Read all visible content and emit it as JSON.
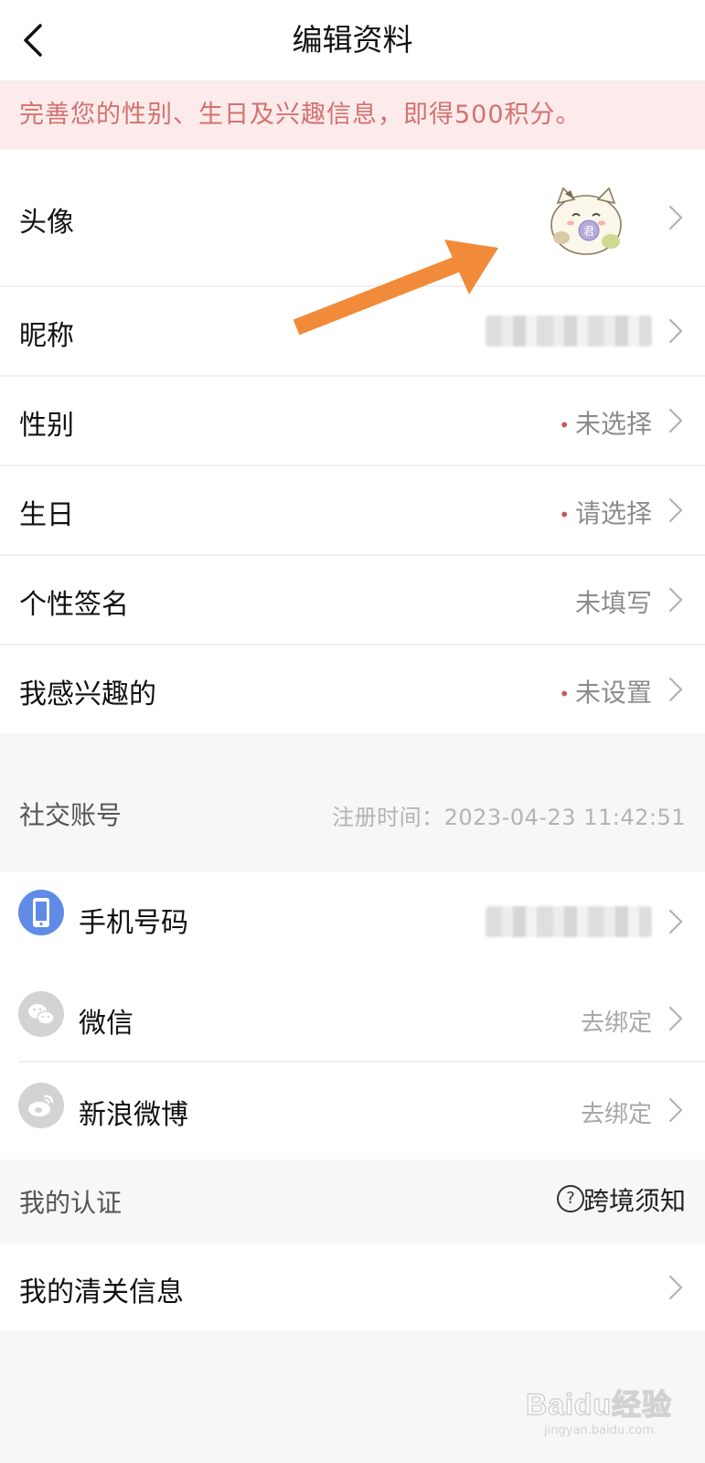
{
  "header": {
    "title": "编辑资料"
  },
  "banner": {
    "text": "完善您的性别、生日及兴趣信息，即得500积分。"
  },
  "profile": {
    "avatar_label": "头像",
    "avatar_badge": "君",
    "nickname_label": "昵称",
    "gender_label": "性别",
    "gender_value": "未选择",
    "birthday_label": "生日",
    "birthday_value": "请选择",
    "signature_label": "个性签名",
    "signature_value": "未填写",
    "interests_label": "我感兴趣的",
    "interests_value": "未设置"
  },
  "social": {
    "title": "社交账号",
    "register_time": "注册时间：2023-04-23 11:42:51",
    "phone_label": "手机号码",
    "wechat_label": "微信",
    "wechat_value": "去绑定",
    "weibo_label": "新浪微博",
    "weibo_value": "去绑定"
  },
  "certification": {
    "title": "我的认证",
    "help_label": "跨境须知",
    "customs_label": "我的清关信息"
  },
  "watermark": {
    "text": "Baidu经验",
    "sub": "jingyan.baidu.com"
  },
  "colors": {
    "banner_bg": "#fcebea",
    "banner_text": "#d27270",
    "accent_dot": "#c95b57",
    "phone_icon": "#5f8be6",
    "annotation_arrow": "#f18b3a"
  }
}
